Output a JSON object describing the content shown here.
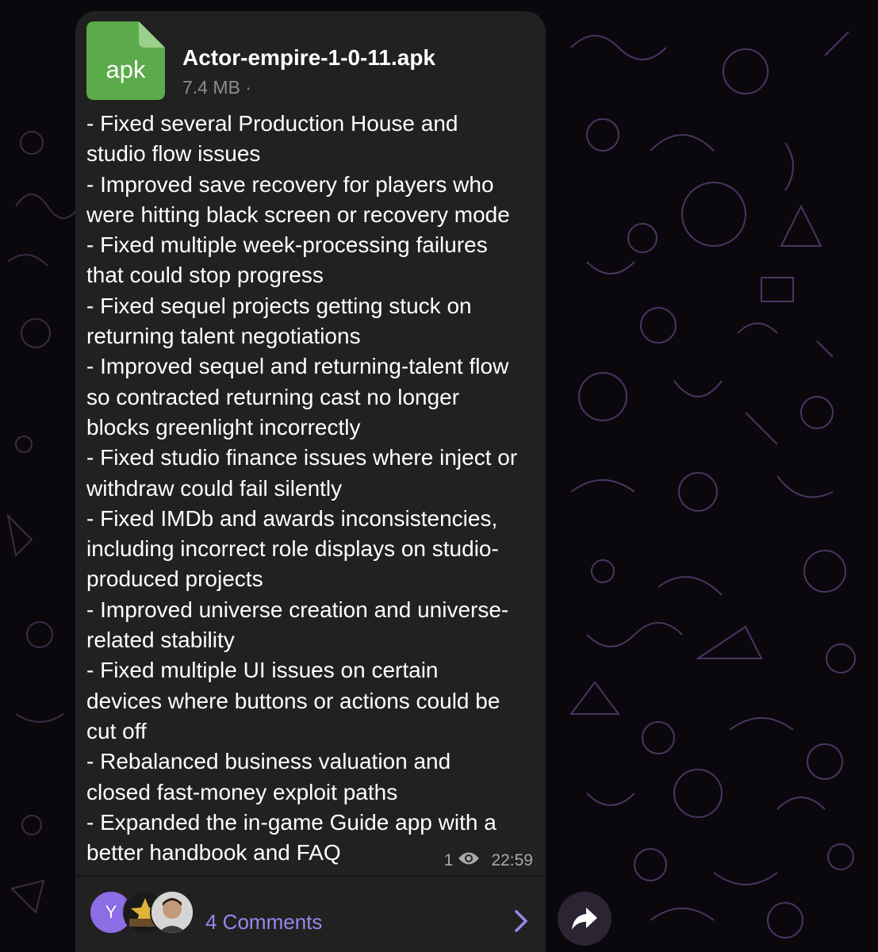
{
  "file": {
    "extension": "apk",
    "name": "Actor-empire-1-0-11.apk",
    "size": "7.4 MB ·",
    "icon": "document-file-icon",
    "icon_color": "#5cab4b"
  },
  "message": {
    "lines": [
      "- Fixed several Production House and",
      "studio flow issues",
      "- Improved save recovery for players who",
      "were hitting black screen or recovery mode",
      "- Fixed multiple week-processing failures",
      "that could stop progress",
      "- Fixed sequel projects getting stuck on",
      "returning talent negotiations",
      "- Improved sequel and returning-talent flow",
      "so contracted returning cast no longer",
      "blocks greenlight incorrectly",
      "- Fixed studio finance issues where inject or",
      "withdraw could fail silently",
      "- Fixed IMDb and awards inconsistencies,",
      "including incorrect role displays on studio-",
      "produced projects",
      "- Improved universe creation and universe-",
      "related stability",
      "- Fixed multiple UI issues on certain",
      "devices where buttons or actions could be",
      "cut off",
      "- Rebalanced business valuation and",
      "closed fast-money exploit paths",
      "- Expanded the in-game Guide app with a",
      "better handbook and FAQ"
    ],
    "views": "1",
    "time": "22:59"
  },
  "comments": {
    "avatar_letter": "Y",
    "label": "4 Comments",
    "accent_color": "#9b86ec"
  },
  "colors": {
    "bubble": "#212121",
    "background": "#0a080d",
    "share_button": "#2b2433"
  }
}
